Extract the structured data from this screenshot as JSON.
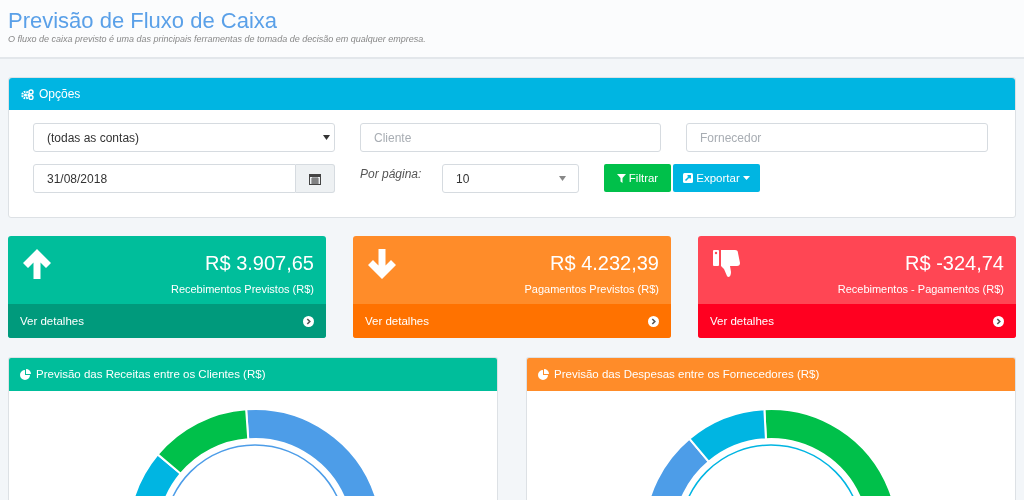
{
  "header": {
    "title": "Previsão de Fluxo de Caixa",
    "subtitle": "O fluxo de caixa previsto é uma das principais ferramentas de tomada de decisão em qualquer empresa."
  },
  "options": {
    "title": "Opções",
    "account_select": {
      "value": "(todas as contas)"
    },
    "client_field": {
      "placeholder": "Cliente"
    },
    "supplier_field": {
      "placeholder": "Fornecedor"
    },
    "date_field": {
      "value": "31/08/2018"
    },
    "per_page": {
      "label": "Por página:",
      "value": "10"
    },
    "buttons": [
      {
        "label": "Filtrar",
        "kind": "filter"
      },
      {
        "label": "Exportar",
        "kind": "export"
      }
    ]
  },
  "cards": [
    {
      "value": "R$ 3.907,65",
      "label": "Recebimentos Previstos (R$)",
      "link": "Ver detalhes",
      "kind": "up"
    },
    {
      "value": "R$ 4.232,39",
      "label": "Pagamentos Previstos (R$)",
      "link": "Ver detalhes",
      "kind": "down"
    },
    {
      "value": "R$ -324,74",
      "label": "Recebimentos - Pagamentos (R$)",
      "link": "Ver detalhes",
      "kind": "thumbs-down"
    }
  ],
  "charts": [
    {
      "title": "Previsão das Receitas entre os Clientes (R$)",
      "color": "#00be9b"
    },
    {
      "title": "Previsão das Despesas entre os Fornecedores (R$)",
      "color": "#ff8c29"
    }
  ]
}
